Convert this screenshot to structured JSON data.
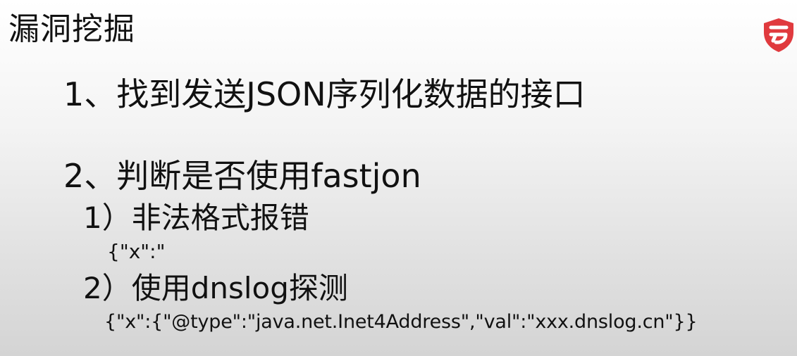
{
  "slide": {
    "title": "漏洞挖掘",
    "lines": [
      "1、找到发送JSON序列化数据的接口",
      "2、判断是否使用fastjon",
      "1）非法格式报错",
      "{\"x\":\"",
      "2）使用dnslog探测",
      "{\"x\":{\"@type\":\"java.net.Inet4Address\",\"val\":\"xxx.dnslog.cn\"}}"
    ]
  },
  "logo": {
    "icon": "shield-logo-icon",
    "color": "#e03a3e"
  }
}
